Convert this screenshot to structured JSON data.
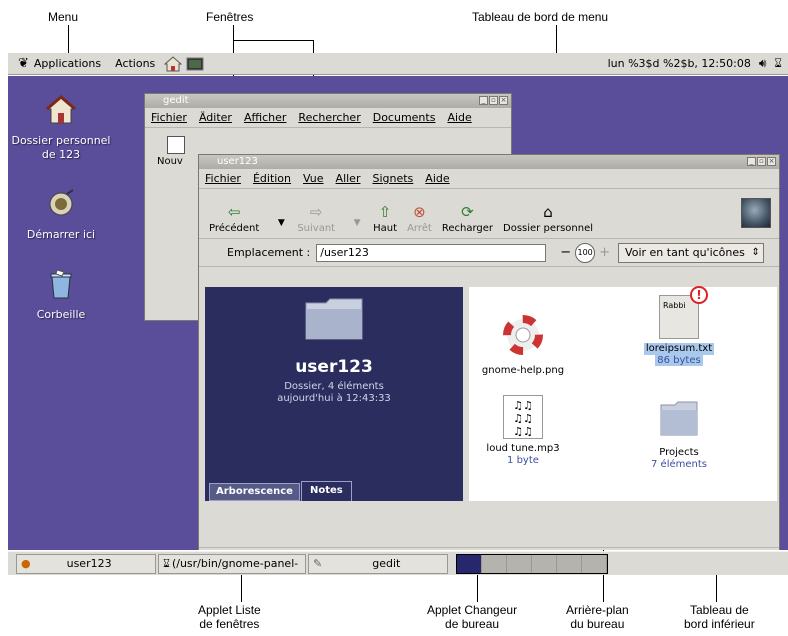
{
  "callouts": {
    "menu": "Menu",
    "fenetres": "Fenêtres",
    "tableau_menu": "Tableau de bord de menu",
    "applet_liste_1": "Applet Liste",
    "applet_liste_2": "de fenêtres",
    "applet_changeur_1": "Applet Changeur",
    "applet_changeur_2": "de bureau",
    "arriere_plan_1": "Arrière-plan",
    "arriere_plan_2": "du bureau",
    "tableau_inferieur_1": "Tableau de",
    "tableau_inferieur_2": "bord inférieur"
  },
  "top_panel": {
    "applications": "Applications",
    "actions": "Actions",
    "clock": "lun %3$d %2$b, 12:50:08"
  },
  "desktop": {
    "home_line1": "Dossier personnel",
    "home_line2": "de 123",
    "start_here": "Démarrer ici",
    "trash": "Corbeille"
  },
  "gedit_window": {
    "title": "gedit",
    "menu": [
      "Fichier",
      "Äditer",
      "Afficher",
      "Rechercher",
      "Documents",
      "Aide"
    ],
    "new_label": "Nouv"
  },
  "nautilus": {
    "title": "user123",
    "menu": [
      "Fichier",
      "Édition",
      "Vue",
      "Aller",
      "Signets",
      "Aide"
    ],
    "toolbar": {
      "back": "Précédent",
      "forward": "Suivant",
      "up": "Haut",
      "stop": "Arrêt",
      "reload": "Recharger",
      "home": "Dossier personnel"
    },
    "location_label": "Emplacement :",
    "location_value": "/user123",
    "zoom": "100",
    "view_as": "Voir en tant qu'icônes",
    "side": {
      "name": "user123",
      "info1": "Dossier, 4 éléments",
      "info2": "aujourd'hui à 12:43:33",
      "tab_tree": "Arborescence",
      "tab_notes": "Notes"
    },
    "files": [
      {
        "name": "gnome-help.png",
        "sub": ""
      },
      {
        "name": "loreipsum.txt",
        "sub": "86 bytes",
        "thumb": "Rabbi"
      },
      {
        "name": "loud tune.mp3",
        "sub": "1 byte"
      },
      {
        "name": "Projects",
        "sub": "7 éléments"
      }
    ]
  },
  "bottom_panel": {
    "task1": "user123",
    "task2": "(/usr/bin/gnome-panel-",
    "task3": "gedit"
  },
  "colors": {
    "desktop": "#5a4d99",
    "sidepane": "#2b2d5e",
    "panel": "#dcdad5",
    "selection": "#a8c8ec"
  }
}
